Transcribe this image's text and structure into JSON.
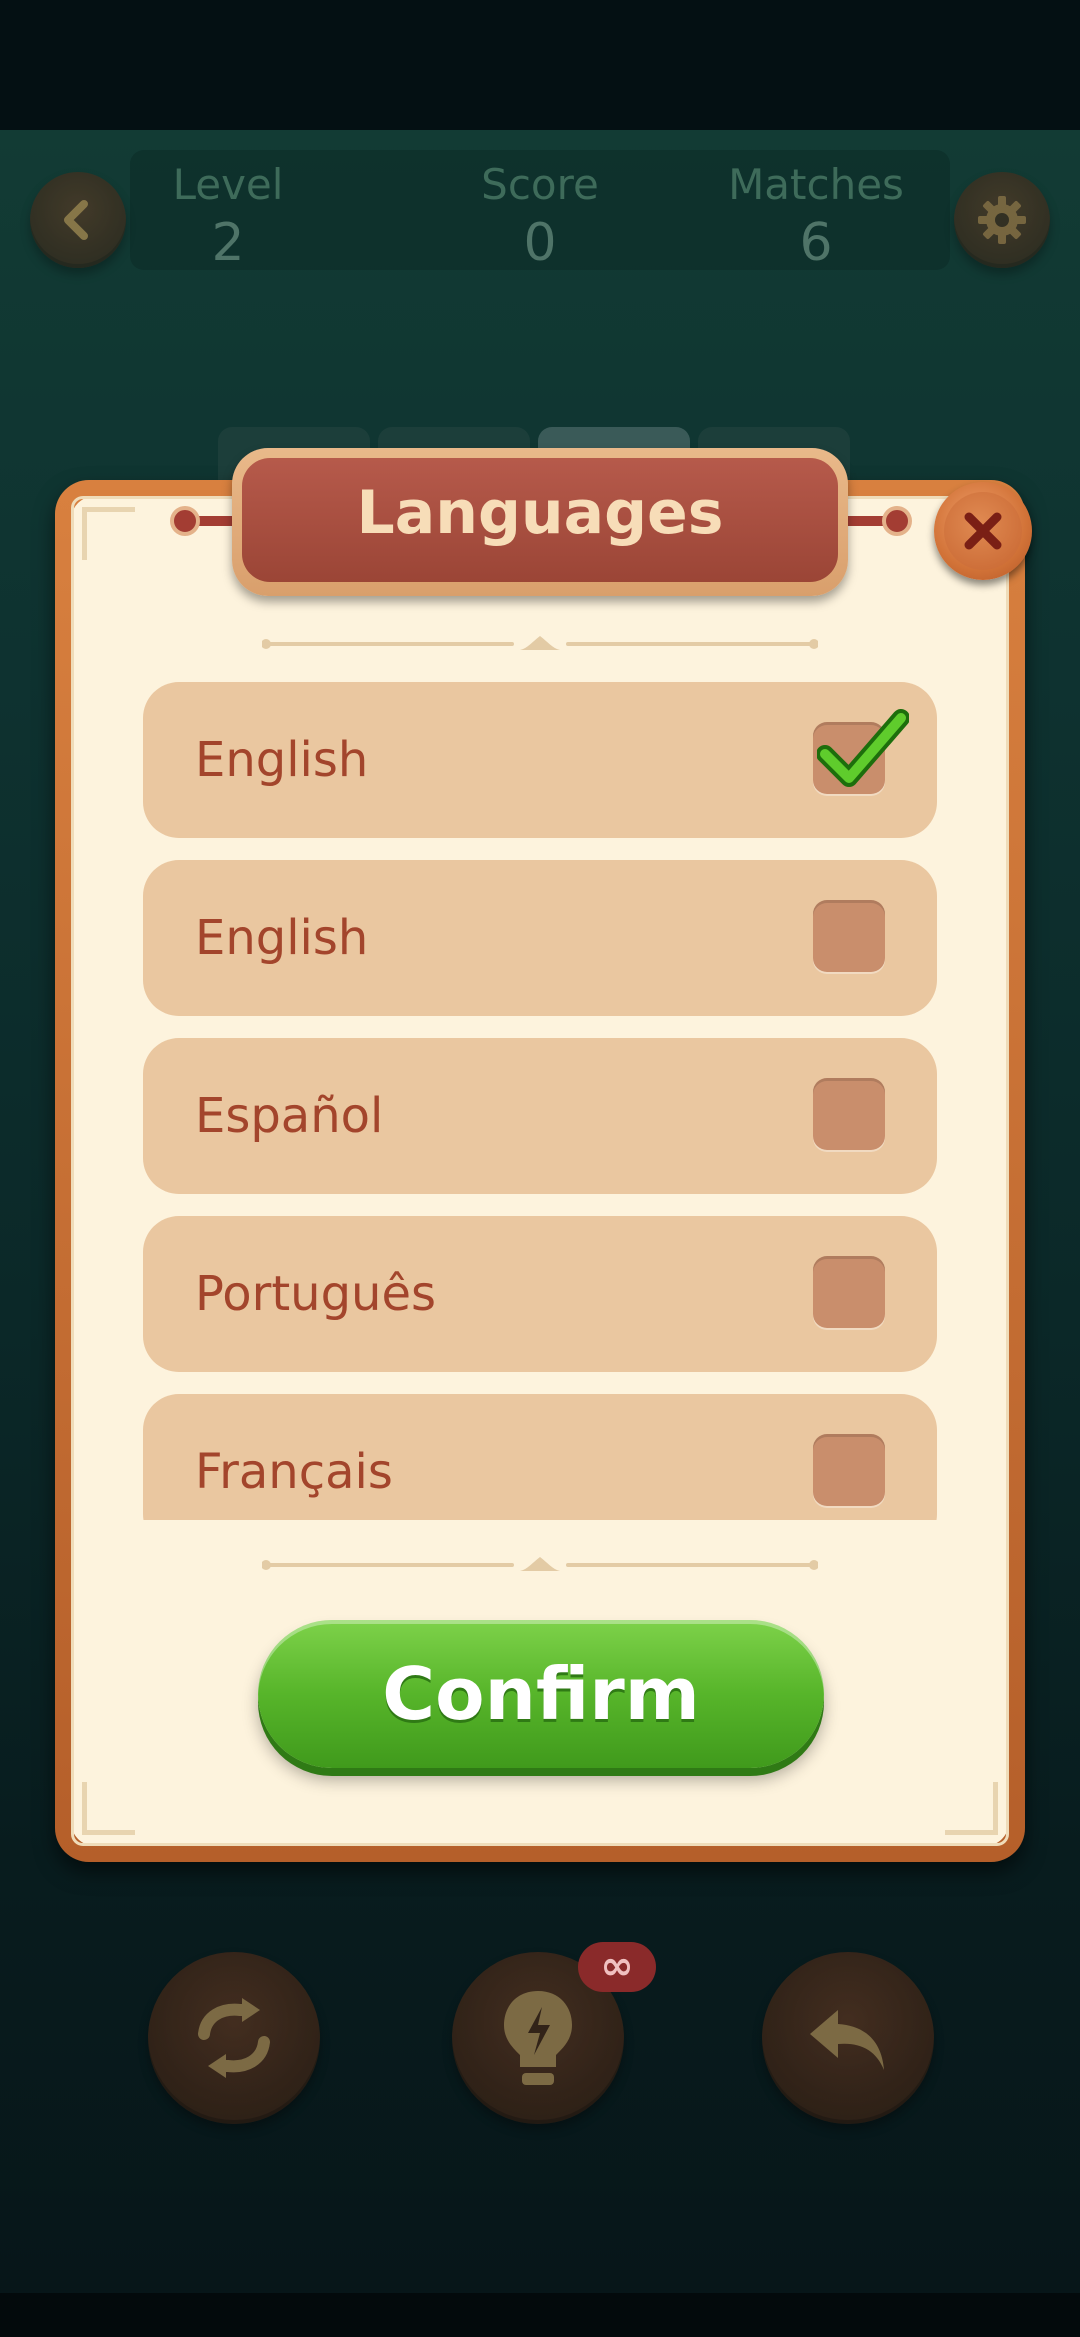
{
  "hud": {
    "level_label": "Level",
    "level_value": "2",
    "score_label": "Score",
    "score_value": "0",
    "matches_label": "Matches",
    "matches_value": "6"
  },
  "dialog": {
    "title": "Languages",
    "languages": [
      {
        "label": "English",
        "checked": true
      },
      {
        "label": "English",
        "checked": false
      },
      {
        "label": "Español",
        "checked": false
      },
      {
        "label": "Português",
        "checked": false
      },
      {
        "label": "Français",
        "checked": false
      }
    ],
    "confirm_label": "Confirm"
  },
  "toolbar": {
    "hint_badge": "∞"
  },
  "colors": {
    "accent_green": "#57b52a",
    "title_red": "#9b4536",
    "row_bg": "#eac7a0",
    "text_brown": "#a3452c"
  },
  "icons": [
    "back-icon",
    "settings-icon",
    "close-icon",
    "shuffle-icon",
    "hint-icon",
    "undo-icon",
    "checkmark-icon"
  ]
}
